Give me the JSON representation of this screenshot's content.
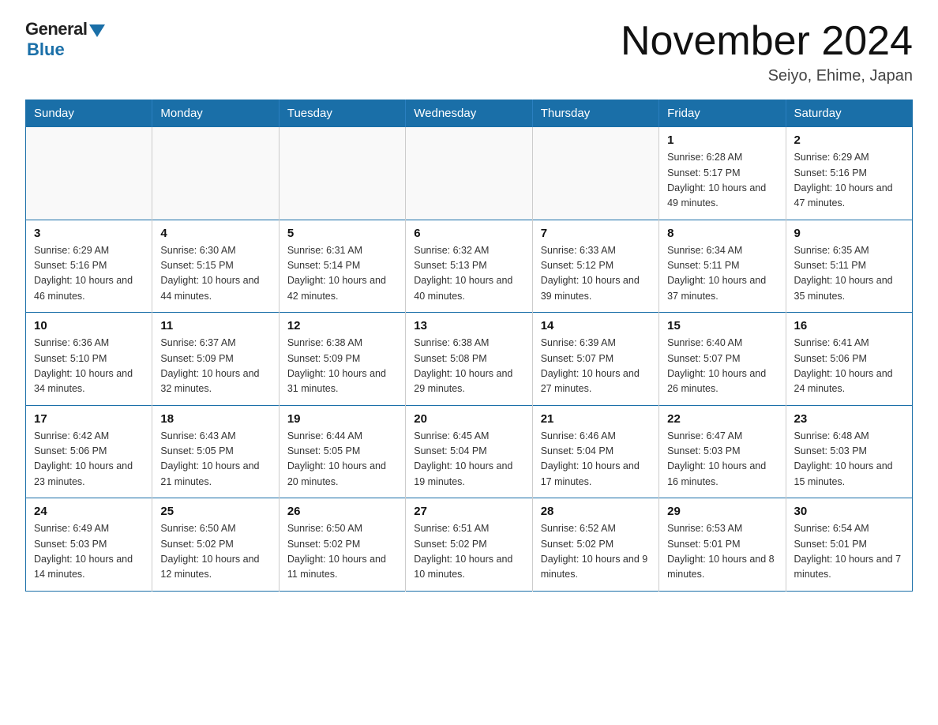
{
  "logo": {
    "general": "General",
    "blue": "Blue"
  },
  "header": {
    "month_year": "November 2024",
    "location": "Seiyo, Ehime, Japan"
  },
  "weekdays": [
    "Sunday",
    "Monday",
    "Tuesday",
    "Wednesday",
    "Thursday",
    "Friday",
    "Saturday"
  ],
  "weeks": [
    [
      {
        "day": "",
        "info": ""
      },
      {
        "day": "",
        "info": ""
      },
      {
        "day": "",
        "info": ""
      },
      {
        "day": "",
        "info": ""
      },
      {
        "day": "",
        "info": ""
      },
      {
        "day": "1",
        "info": "Sunrise: 6:28 AM\nSunset: 5:17 PM\nDaylight: 10 hours and 49 minutes."
      },
      {
        "day": "2",
        "info": "Sunrise: 6:29 AM\nSunset: 5:16 PM\nDaylight: 10 hours and 47 minutes."
      }
    ],
    [
      {
        "day": "3",
        "info": "Sunrise: 6:29 AM\nSunset: 5:16 PM\nDaylight: 10 hours and 46 minutes."
      },
      {
        "day": "4",
        "info": "Sunrise: 6:30 AM\nSunset: 5:15 PM\nDaylight: 10 hours and 44 minutes."
      },
      {
        "day": "5",
        "info": "Sunrise: 6:31 AM\nSunset: 5:14 PM\nDaylight: 10 hours and 42 minutes."
      },
      {
        "day": "6",
        "info": "Sunrise: 6:32 AM\nSunset: 5:13 PM\nDaylight: 10 hours and 40 minutes."
      },
      {
        "day": "7",
        "info": "Sunrise: 6:33 AM\nSunset: 5:12 PM\nDaylight: 10 hours and 39 minutes."
      },
      {
        "day": "8",
        "info": "Sunrise: 6:34 AM\nSunset: 5:11 PM\nDaylight: 10 hours and 37 minutes."
      },
      {
        "day": "9",
        "info": "Sunrise: 6:35 AM\nSunset: 5:11 PM\nDaylight: 10 hours and 35 minutes."
      }
    ],
    [
      {
        "day": "10",
        "info": "Sunrise: 6:36 AM\nSunset: 5:10 PM\nDaylight: 10 hours and 34 minutes."
      },
      {
        "day": "11",
        "info": "Sunrise: 6:37 AM\nSunset: 5:09 PM\nDaylight: 10 hours and 32 minutes."
      },
      {
        "day": "12",
        "info": "Sunrise: 6:38 AM\nSunset: 5:09 PM\nDaylight: 10 hours and 31 minutes."
      },
      {
        "day": "13",
        "info": "Sunrise: 6:38 AM\nSunset: 5:08 PM\nDaylight: 10 hours and 29 minutes."
      },
      {
        "day": "14",
        "info": "Sunrise: 6:39 AM\nSunset: 5:07 PM\nDaylight: 10 hours and 27 minutes."
      },
      {
        "day": "15",
        "info": "Sunrise: 6:40 AM\nSunset: 5:07 PM\nDaylight: 10 hours and 26 minutes."
      },
      {
        "day": "16",
        "info": "Sunrise: 6:41 AM\nSunset: 5:06 PM\nDaylight: 10 hours and 24 minutes."
      }
    ],
    [
      {
        "day": "17",
        "info": "Sunrise: 6:42 AM\nSunset: 5:06 PM\nDaylight: 10 hours and 23 minutes."
      },
      {
        "day": "18",
        "info": "Sunrise: 6:43 AM\nSunset: 5:05 PM\nDaylight: 10 hours and 21 minutes."
      },
      {
        "day": "19",
        "info": "Sunrise: 6:44 AM\nSunset: 5:05 PM\nDaylight: 10 hours and 20 minutes."
      },
      {
        "day": "20",
        "info": "Sunrise: 6:45 AM\nSunset: 5:04 PM\nDaylight: 10 hours and 19 minutes."
      },
      {
        "day": "21",
        "info": "Sunrise: 6:46 AM\nSunset: 5:04 PM\nDaylight: 10 hours and 17 minutes."
      },
      {
        "day": "22",
        "info": "Sunrise: 6:47 AM\nSunset: 5:03 PM\nDaylight: 10 hours and 16 minutes."
      },
      {
        "day": "23",
        "info": "Sunrise: 6:48 AM\nSunset: 5:03 PM\nDaylight: 10 hours and 15 minutes."
      }
    ],
    [
      {
        "day": "24",
        "info": "Sunrise: 6:49 AM\nSunset: 5:03 PM\nDaylight: 10 hours and 14 minutes."
      },
      {
        "day": "25",
        "info": "Sunrise: 6:50 AM\nSunset: 5:02 PM\nDaylight: 10 hours and 12 minutes."
      },
      {
        "day": "26",
        "info": "Sunrise: 6:50 AM\nSunset: 5:02 PM\nDaylight: 10 hours and 11 minutes."
      },
      {
        "day": "27",
        "info": "Sunrise: 6:51 AM\nSunset: 5:02 PM\nDaylight: 10 hours and 10 minutes."
      },
      {
        "day": "28",
        "info": "Sunrise: 6:52 AM\nSunset: 5:02 PM\nDaylight: 10 hours and 9 minutes."
      },
      {
        "day": "29",
        "info": "Sunrise: 6:53 AM\nSunset: 5:01 PM\nDaylight: 10 hours and 8 minutes."
      },
      {
        "day": "30",
        "info": "Sunrise: 6:54 AM\nSunset: 5:01 PM\nDaylight: 10 hours and 7 minutes."
      }
    ]
  ]
}
